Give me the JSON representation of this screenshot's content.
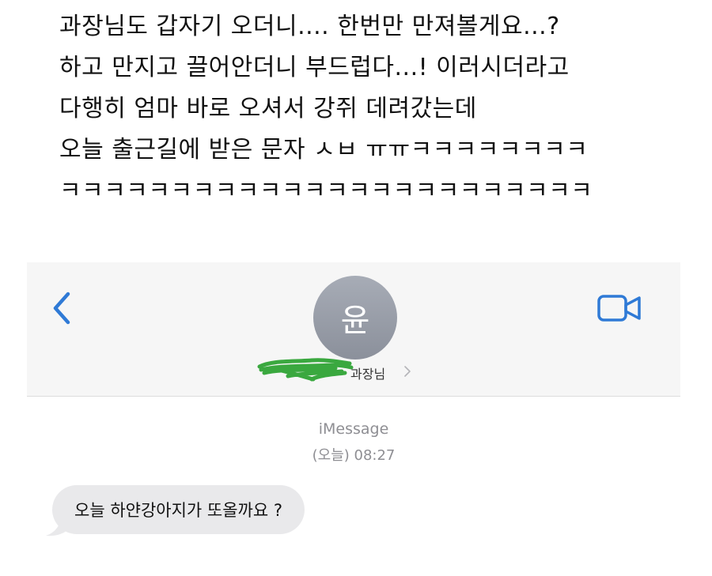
{
  "caption": {
    "lines": [
      "과장님도 갑자기 오더니.... 한번만 만져볼게요...?",
      "하고 만지고 끌어안더니 부드럽다...! 이러시더라고",
      "다행히 엄마 바로 오셔서 강쥐 데려갔는데",
      "오늘 출근길에 받은 문자 ㅅㅂ ㅠㅠㅋㅋㅋㅋㅋㅋㅋㅋ",
      "ㅋㅋㅋㅋㅋㅋㅋㅋㅋㅋㅋㅋㅋㅋㅋㅋㅋㅋㅋㅋㅋㅋㅋㅋ"
    ]
  },
  "header": {
    "avatar_initial": "윤",
    "contact_name": "과장님",
    "back_icon": "chevron-left-icon",
    "video_icon": "video-camera-icon",
    "accent_color": "#2f7ad6"
  },
  "thread": {
    "service": "iMessage",
    "timestamp": "(오늘) 08:27",
    "messages": [
      {
        "text": "오늘 하얀강아지가 또올까요 ?",
        "direction": "incoming"
      }
    ]
  }
}
